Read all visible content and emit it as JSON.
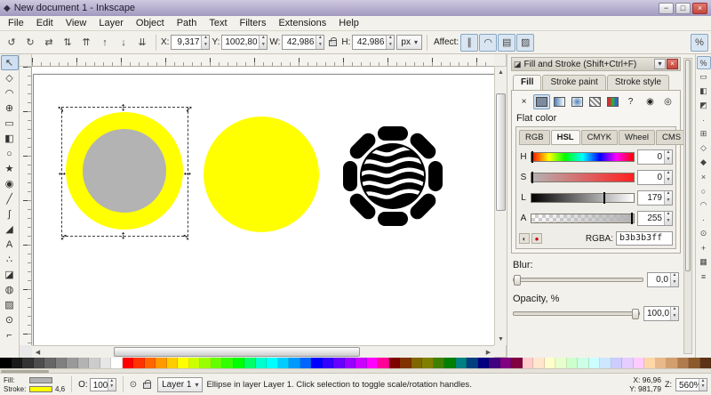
{
  "window": {
    "title": "New document 1 - Inkscape",
    "icon_glyph": "◆"
  },
  "titlebar": {
    "buttons": [
      {
        "name": "minimize-button",
        "glyph": "−"
      },
      {
        "name": "maximize-button",
        "glyph": "□"
      },
      {
        "name": "close-button",
        "glyph": "×"
      }
    ]
  },
  "menu": {
    "items": [
      "File",
      "Edit",
      "View",
      "Layer",
      "Object",
      "Path",
      "Text",
      "Filters",
      "Extensions",
      "Help"
    ]
  },
  "ctrl": {
    "icons": [
      {
        "name": "rotate-ccw",
        "glyph": "↺"
      },
      {
        "name": "rotate-cw",
        "glyph": "↻"
      },
      {
        "name": "flip-horizontal",
        "glyph": "⇄"
      },
      {
        "name": "flip-vertical",
        "glyph": "⇅"
      },
      {
        "name": "raise-to-top",
        "glyph": "⇈"
      },
      {
        "name": "raise",
        "glyph": "↑"
      },
      {
        "name": "lower",
        "glyph": "↓"
      },
      {
        "name": "lower-to-bottom",
        "glyph": "⇊"
      }
    ],
    "x_label": "X:",
    "x": "9,317",
    "y_label": "Y:",
    "y": "1002,80",
    "w_label": "W:",
    "w": "42,986",
    "h_label": "H:",
    "h": "42,986",
    "unit": "px",
    "affect_label": "Affect:",
    "affect": [
      {
        "name": "affect-scale-stroke",
        "glyph": "∥",
        "pressed": true
      },
      {
        "name": "affect-scale-corners",
        "glyph": "◠",
        "pressed": true
      },
      {
        "name": "affect-move-gradients",
        "glyph": "▤",
        "pressed": true
      },
      {
        "name": "affect-move-patterns",
        "glyph": "▨",
        "pressed": true
      }
    ],
    "snap_toggle_glyph": "%"
  },
  "toolbox": [
    {
      "name": "selector-tool",
      "glyph": "↖",
      "active": true
    },
    {
      "name": "node-tool",
      "glyph": "◇"
    },
    {
      "name": "tweak-tool",
      "glyph": "◠"
    },
    {
      "name": "zoom-tool",
      "glyph": "⊕"
    },
    {
      "name": "rectangle-tool",
      "glyph": "▭"
    },
    {
      "name": "box3d-tool",
      "glyph": "◧"
    },
    {
      "name": "ellipse-tool",
      "glyph": "○"
    },
    {
      "name": "star-tool",
      "glyph": "★"
    },
    {
      "name": "spiral-tool",
      "glyph": "◉"
    },
    {
      "name": "pencil-tool",
      "glyph": "╱"
    },
    {
      "name": "pen-tool",
      "glyph": "∫"
    },
    {
      "name": "calligraphy-tool",
      "glyph": "◢"
    },
    {
      "name": "text-tool",
      "glyph": "A"
    },
    {
      "name": "spray-tool",
      "glyph": "∴"
    },
    {
      "name": "eraser-tool",
      "glyph": "◪"
    },
    {
      "name": "paint-bucket-tool",
      "glyph": "◍"
    },
    {
      "name": "gradient-tool",
      "glyph": "▨"
    },
    {
      "name": "dropper-tool",
      "glyph": "⊙"
    },
    {
      "name": "connector-tool",
      "glyph": "⌐"
    }
  ],
  "canvas": {
    "handle_glyph": "↔",
    "shapes": [
      {
        "name": "ellipse-gray-yellow",
        "fill": "#b3b3b3",
        "stroke": "#ffff00",
        "selected": true
      },
      {
        "name": "ellipse-yellow",
        "fill": "#ffff00",
        "stroke": "none"
      },
      {
        "name": "flower-black",
        "fill": "#000000",
        "stripes": "#ffffff"
      }
    ]
  },
  "fill_stroke": {
    "title": "Fill and Stroke (Shift+Ctrl+F)",
    "header_icon": "◪",
    "header_buttons": [
      {
        "name": "dock-menu-button",
        "glyph": "▾"
      },
      {
        "name": "dock-close-button",
        "glyph": "×"
      }
    ],
    "tabs": [
      "Fill",
      "Stroke paint",
      "Stroke style"
    ],
    "active_tab": "Fill",
    "paint_buttons": [
      {
        "name": "no-paint",
        "glyph": "×"
      },
      {
        "name": "flat-color",
        "glyph": "",
        "selected": true
      },
      {
        "name": "linear-gradient",
        "glyph": ""
      },
      {
        "name": "radial-gradient",
        "glyph": ""
      },
      {
        "name": "pattern",
        "glyph": ""
      },
      {
        "name": "swatch",
        "glyph": ""
      },
      {
        "name": "unknown-paint",
        "glyph": "?"
      }
    ],
    "fill_rule_buttons": [
      {
        "name": "fill-rule-nonzero",
        "glyph": "◉"
      },
      {
        "name": "fill-rule-evenodd",
        "glyph": "◎"
      }
    ],
    "flat_color_label": "Flat color",
    "color_tabs": [
      "RGB",
      "HSL",
      "CMYK",
      "Wheel",
      "CMS"
    ],
    "active_color_tab": "HSL",
    "channels": [
      {
        "label": "H",
        "value": "0"
      },
      {
        "label": "S",
        "value": "0"
      },
      {
        "label": "L",
        "value": "179"
      },
      {
        "label": "A",
        "value": "255"
      }
    ],
    "rgba_icons": [
      {
        "name": "color-wheel-icon",
        "glyph": "◐"
      },
      {
        "name": "gamut-warning-icon",
        "glyph": "●"
      }
    ],
    "rgba_label": "RGBA:",
    "rgba_value": "b3b3b3ff",
    "blur_label": "Blur:",
    "blur_value": "0,0",
    "opacity_label": "Opacity, %",
    "opacity_value": "100,0"
  },
  "snapbar": [
    {
      "name": "snap-toggle",
      "glyph": "%",
      "pressed": true
    },
    {
      "name": "snap-bounding-box",
      "glyph": "▭"
    },
    {
      "name": "snap-bbox-edges",
      "glyph": "◧"
    },
    {
      "name": "snap-bbox-corners",
      "glyph": "◩"
    },
    {
      "name": "snap-bbox-midpoints",
      "glyph": "∙"
    },
    {
      "name": "snap-bbox-centers",
      "glyph": "⊞"
    },
    {
      "name": "snap-nodes",
      "glyph": "◇"
    },
    {
      "name": "snap-paths",
      "glyph": "◆"
    },
    {
      "name": "snap-path-intersections",
      "glyph": "×"
    },
    {
      "name": "snap-cusp-nodes",
      "glyph": "○"
    },
    {
      "name": "snap-smooth-nodes",
      "glyph": "◠"
    },
    {
      "name": "snap-midpoints",
      "glyph": "·"
    },
    {
      "name": "snap-object-centers",
      "glyph": "⊙"
    },
    {
      "name": "snap-rotation-centers",
      "glyph": "+"
    },
    {
      "name": "snap-grid",
      "glyph": "▦"
    },
    {
      "name": "snap-guides",
      "glyph": "≡"
    }
  ],
  "palette": [
    "#000000",
    "#1a1a1a",
    "#333333",
    "#4d4d4d",
    "#666666",
    "#808080",
    "#999999",
    "#b3b3b3",
    "#cccccc",
    "#e6e6e6",
    "#ffffff",
    "#ff0000",
    "#ff3300",
    "#ff6600",
    "#ff9900",
    "#ffcc00",
    "#ffff00",
    "#ccff00",
    "#99ff00",
    "#66ff00",
    "#33ff00",
    "#00ff00",
    "#00ff66",
    "#00ffcc",
    "#00ffff",
    "#00ccff",
    "#0099ff",
    "#0066ff",
    "#0000ff",
    "#3300ff",
    "#6600ff",
    "#9900ff",
    "#cc00ff",
    "#ff00ff",
    "#ff0099",
    "#800000",
    "#803300",
    "#806600",
    "#808000",
    "#408000",
    "#008000",
    "#008080",
    "#004080",
    "#000080",
    "#400080",
    "#800080",
    "#800040",
    "#ffcccc",
    "#ffe6cc",
    "#ffffcc",
    "#e6ffcc",
    "#ccffcc",
    "#ccffe6",
    "#ccffff",
    "#cce6ff",
    "#ccccff",
    "#e6ccff",
    "#ffccff",
    "#ffd6a8",
    "#e8b98a",
    "#d2a06e",
    "#b07c4f",
    "#8b5a2b",
    "#5c3317"
  ],
  "statusbar": {
    "fill_label": "Fill:",
    "stroke_label": "Stroke:",
    "fill_color": "#b3b3b3",
    "stroke_color": "#ffff00",
    "stroke_width": "4,6",
    "opacity_label": "O:",
    "opacity_value": "100",
    "eye_glyph": "⊙",
    "layer_name": "Layer 1",
    "message": "Ellipse in layer Layer 1. Click selection to toggle scale/rotation handles.",
    "cursor_x_label": "X:",
    "cursor_x": "96,96",
    "cursor_y_label": "Y:",
    "cursor_y": "981,79",
    "zoom_label": "Z:",
    "zoom": "560%"
  }
}
